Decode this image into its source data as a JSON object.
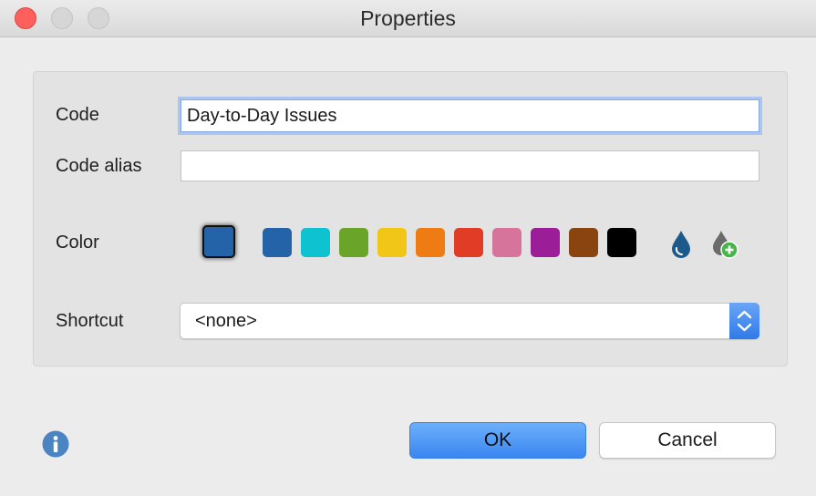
{
  "window": {
    "title": "Properties"
  },
  "form": {
    "code_label": "Code",
    "code_value": "Day-to-Day Issues",
    "alias_label": "Code alias",
    "alias_value": "",
    "color_label": "Color",
    "shortcut_label": "Shortcut",
    "shortcut_value": "<none>"
  },
  "colors": {
    "selected": "#2463a8",
    "palette": [
      "#2463a8",
      "#0ec3cf",
      "#6aa52a",
      "#f2c616",
      "#ef7c12",
      "#e13c26",
      "#d7749c",
      "#9b1e98",
      "#8a4410",
      "#000000"
    ],
    "eyedropper_color": "#1d5a8c",
    "add_color_badge": "#46b649"
  },
  "buttons": {
    "ok": "OK",
    "cancel": "Cancel"
  },
  "icons": {
    "info": "info-icon",
    "picker": "color-drop-icon",
    "add_color": "add-color-drop-icon"
  }
}
